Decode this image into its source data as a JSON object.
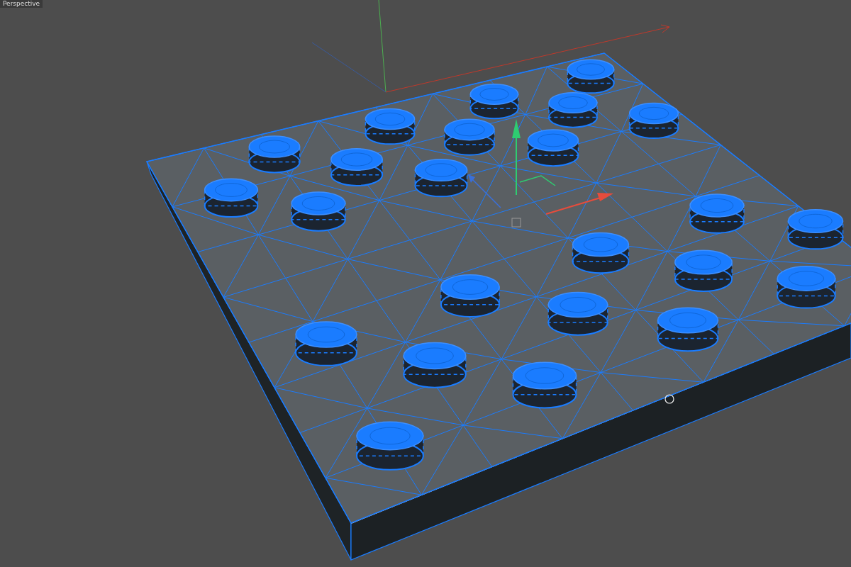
{
  "viewport": {
    "label": "Perspective"
  }
}
